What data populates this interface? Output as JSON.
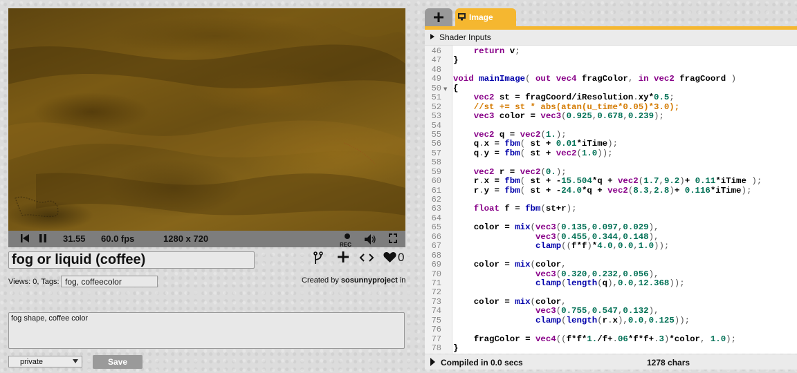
{
  "player": {
    "time": "31.55",
    "fps": "60.0 fps",
    "resolution": "1280 x 720",
    "rec_label": "REC"
  },
  "shader": {
    "title": "fog or liquid (coffee)",
    "likes": "0",
    "views_label": "Views: 0, Tags:",
    "tags": "fog, coffeecolor",
    "created_prefix": "Created by ",
    "author": "sosunnyproject",
    "created_suffix": " in",
    "description": "fog shape, coffee color",
    "privacy": "private",
    "save_label": "Save"
  },
  "editor": {
    "tab_label": "Image",
    "shader_inputs_label": "Shader Inputs",
    "status": "Compiled in 0.0 secs",
    "chars": "1278 chars",
    "lines": [
      {
        "n": "46",
        "code": "    return v;"
      },
      {
        "n": "47",
        "code": "}"
      },
      {
        "n": "48",
        "code": ""
      },
      {
        "n": "49",
        "code": "void mainImage( out vec4 fragColor, in vec2 fragCoord )"
      },
      {
        "n": "50",
        "code": "{"
      },
      {
        "n": "51",
        "code": "    vec2 st = fragCoord/iResolution.xy*0.5;"
      },
      {
        "n": "52",
        "code": "    //st += st * abs(atan(u_time*0.05)*3.0);"
      },
      {
        "n": "53",
        "code": "    vec3 color = vec3(0.925,0.678,0.239);"
      },
      {
        "n": "54",
        "code": ""
      },
      {
        "n": "55",
        "code": "    vec2 q = vec2(1.);"
      },
      {
        "n": "56",
        "code": "    q.x = fbm( st + 0.01*iTime);"
      },
      {
        "n": "57",
        "code": "    q.y = fbm( st + vec2(1.0));"
      },
      {
        "n": "58",
        "code": ""
      },
      {
        "n": "59",
        "code": "    vec2 r = vec2(0.);"
      },
      {
        "n": "60",
        "code": "    r.x = fbm( st + -15.504*q + vec2(1.7,9.2)+ 0.11*iTime );"
      },
      {
        "n": "61",
        "code": "    r.y = fbm( st + -24.0*q + vec2(8.3,2.8)+ 0.116*iTime);"
      },
      {
        "n": "62",
        "code": ""
      },
      {
        "n": "63",
        "code": "    float f = fbm(st+r);"
      },
      {
        "n": "64",
        "code": ""
      },
      {
        "n": "65",
        "code": "    color = mix(vec3(0.135,0.097,0.029),"
      },
      {
        "n": "66",
        "code": "                vec3(0.455,0.344,0.148),"
      },
      {
        "n": "67",
        "code": "                clamp((f*f)*4.0,0.0,1.0));"
      },
      {
        "n": "68",
        "code": ""
      },
      {
        "n": "69",
        "code": "    color = mix(color,"
      },
      {
        "n": "70",
        "code": "                vec3(0.320,0.232,0.056),"
      },
      {
        "n": "71",
        "code": "                clamp(length(q),0.0,12.368));"
      },
      {
        "n": "72",
        "code": ""
      },
      {
        "n": "73",
        "code": "    color = mix(color,"
      },
      {
        "n": "74",
        "code": "                vec3(0.755,0.547,0.132),"
      },
      {
        "n": "75",
        "code": "                clamp(length(r.x),0.0,0.125));"
      },
      {
        "n": "76",
        "code": ""
      },
      {
        "n": "77",
        "code": "    fragColor = vec4((f*f*1./f+.06*f*f+.3)*color, 1.0);"
      },
      {
        "n": "78",
        "code": "}"
      }
    ]
  },
  "colors": {
    "accent": "#f5b730",
    "keyword": "#880088",
    "function": "#0000aa",
    "number": "#007055",
    "comment": "#d47a00"
  }
}
